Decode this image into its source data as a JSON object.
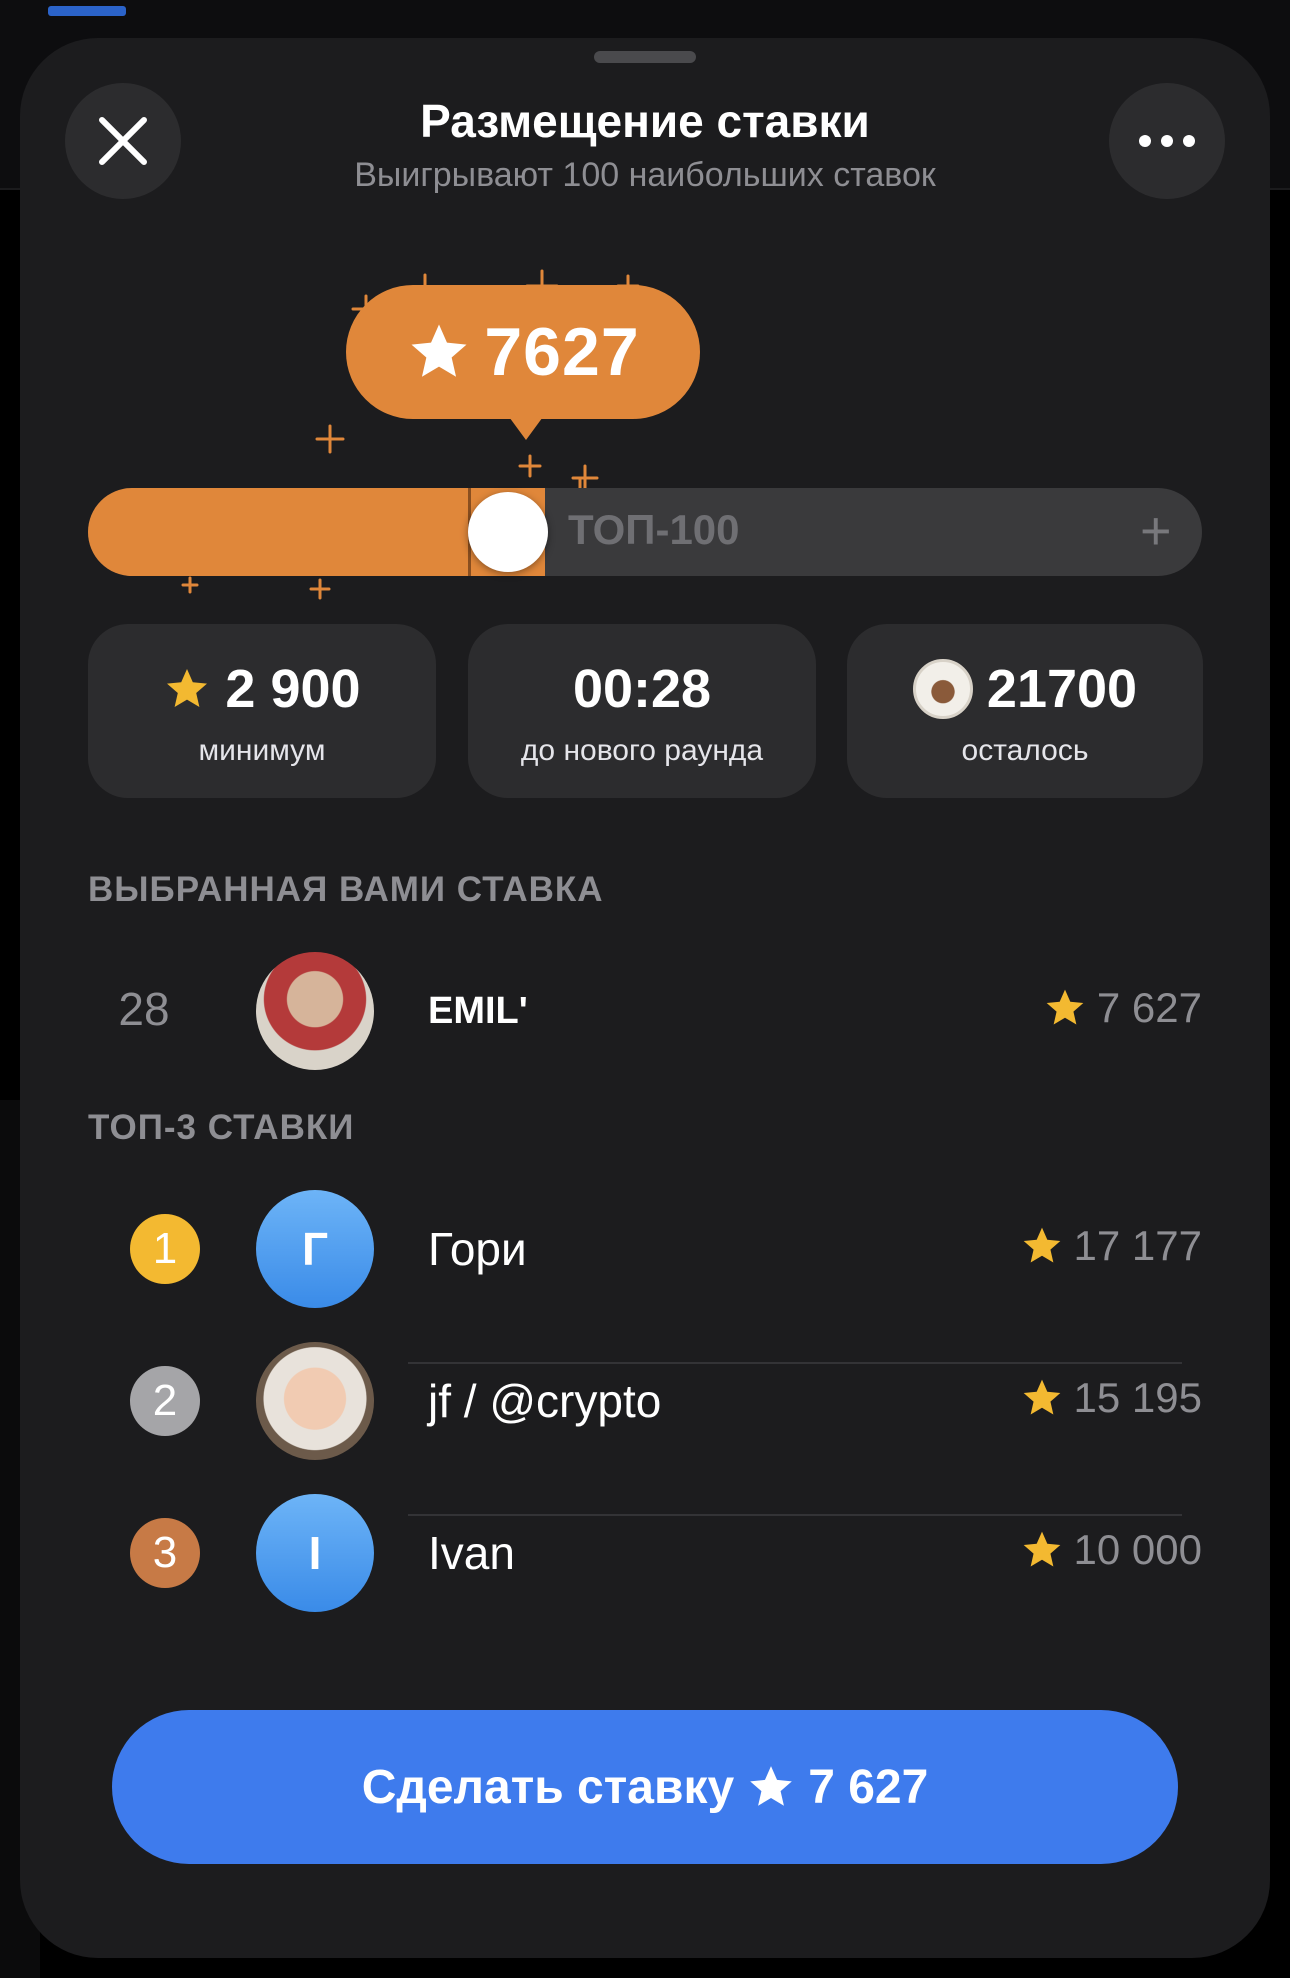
{
  "header": {
    "title": "Размещение ставки",
    "subtitle": "Выигрывают 100 наибольших ставок",
    "close_icon": "close-icon",
    "more_icon": "more-icon"
  },
  "bid_bubble": {
    "value": "7627",
    "icon": "star-icon"
  },
  "slider": {
    "label": "ТОП-100",
    "plus_label": "+",
    "fill_fraction": 0.41
  },
  "stats": [
    {
      "value": "2 900",
      "label": "минимум",
      "icon": "star-icon"
    },
    {
      "value": "00:28",
      "label": "до нового раунда"
    },
    {
      "value": "21700",
      "label": "осталось",
      "icon": "cake-icon"
    }
  ],
  "my_bid": {
    "section_title": "ВЫБРАННАЯ ВАМИ СТАВКА",
    "rank": "28",
    "name": "EMILʹ",
    "amount": "7 627"
  },
  "top3": {
    "section_title": "ТОП-3 СТАВКИ",
    "rows": [
      {
        "rank": "1",
        "initial": "Г",
        "name": "Гори",
        "amount": "17 177"
      },
      {
        "rank": "2",
        "initial": "",
        "name": "jf / @crypto",
        "amount": "15 195"
      },
      {
        "rank": "3",
        "initial": "I",
        "name": "Ivan",
        "amount": "10 000"
      }
    ]
  },
  "cta": {
    "label": "Сделать ставку",
    "amount": "7 627"
  },
  "colors": {
    "accent_orange": "#e0873a",
    "button_blue": "#3e7bed",
    "sheet_bg": "#1c1c1e",
    "card_bg": "#2c2c2e",
    "gold": "#f3b931",
    "silver": "#a5a5a8",
    "bronze": "#c77a46"
  }
}
